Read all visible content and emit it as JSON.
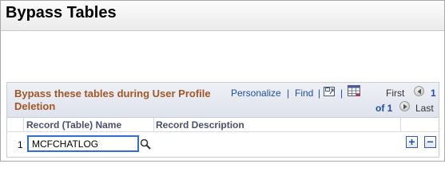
{
  "page": {
    "title": "Bypass Tables"
  },
  "grid": {
    "title": "Bypass these tables during User Profile Deletion",
    "personalize": "Personalize",
    "separator": "|",
    "find": "Find",
    "nav": {
      "first": "First",
      "current": "1",
      "of": "of 1",
      "last": "Last"
    },
    "columns": [
      "Record (Table) Name",
      "Record Description"
    ],
    "rows": [
      {
        "num": "1",
        "record": "MCFCHATLOG",
        "description": ""
      }
    ],
    "buttons": {
      "add": "+",
      "delete": "−"
    }
  },
  "colors": {
    "title": "#a15726",
    "link": "#1d4ea5",
    "focus": "#2f6fd0"
  },
  "icons": [
    "view-all-icon",
    "download-grid-icon",
    "previous-icon",
    "next-icon",
    "lookup-icon",
    "add-row-icon",
    "delete-row-icon"
  ]
}
